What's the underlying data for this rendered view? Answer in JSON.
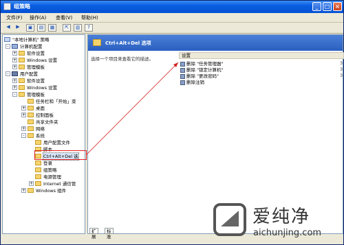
{
  "window": {
    "title": "组策略"
  },
  "menubar": {
    "items": [
      "文件(F)",
      "操作(A)",
      "查看(V)",
      "帮助(H)"
    ]
  },
  "tree": {
    "root": "\"本地计算机\" 策略",
    "computer_config": "计算机配置",
    "cc_software": "软件设置",
    "cc_windows": "Windows 设置",
    "cc_admin": "管理模板",
    "user_config": "用户配置",
    "uc_software": "软件设置",
    "uc_windows": "Windows 设置",
    "uc_admin": "管理模板",
    "taskbar": "任务栏和「开始」菜",
    "desktop": "桌面",
    "control_panel": "控制面板",
    "shared_folders": "共享文件夹",
    "network": "网络",
    "system": "系统",
    "user_profiles": "用户配置文件",
    "scripts": "脚本",
    "ctrl_alt_del": "Ctrl+Alt+Del 选",
    "logon": "登录",
    "group_policy": "组策略",
    "power": "电源管理",
    "internet": "Internet 通信管",
    "windows_components": "Windows 组件"
  },
  "right": {
    "heading": "Ctrl+Alt+Del 选项",
    "description": "选择一个项目来查看它的描述。",
    "column_header": "设置",
    "rows": [
      "删除 \"任务管理器\"",
      "删除 \"锁定计算机\"",
      "删除 \"更改密码\"",
      "删除注销"
    ],
    "states": [
      "3",
      "3",
      "3"
    ]
  },
  "tabs": [
    "扩展",
    "标准"
  ],
  "watermark": {
    "cn": "爱纯净",
    "en": "aichunjing.com"
  }
}
